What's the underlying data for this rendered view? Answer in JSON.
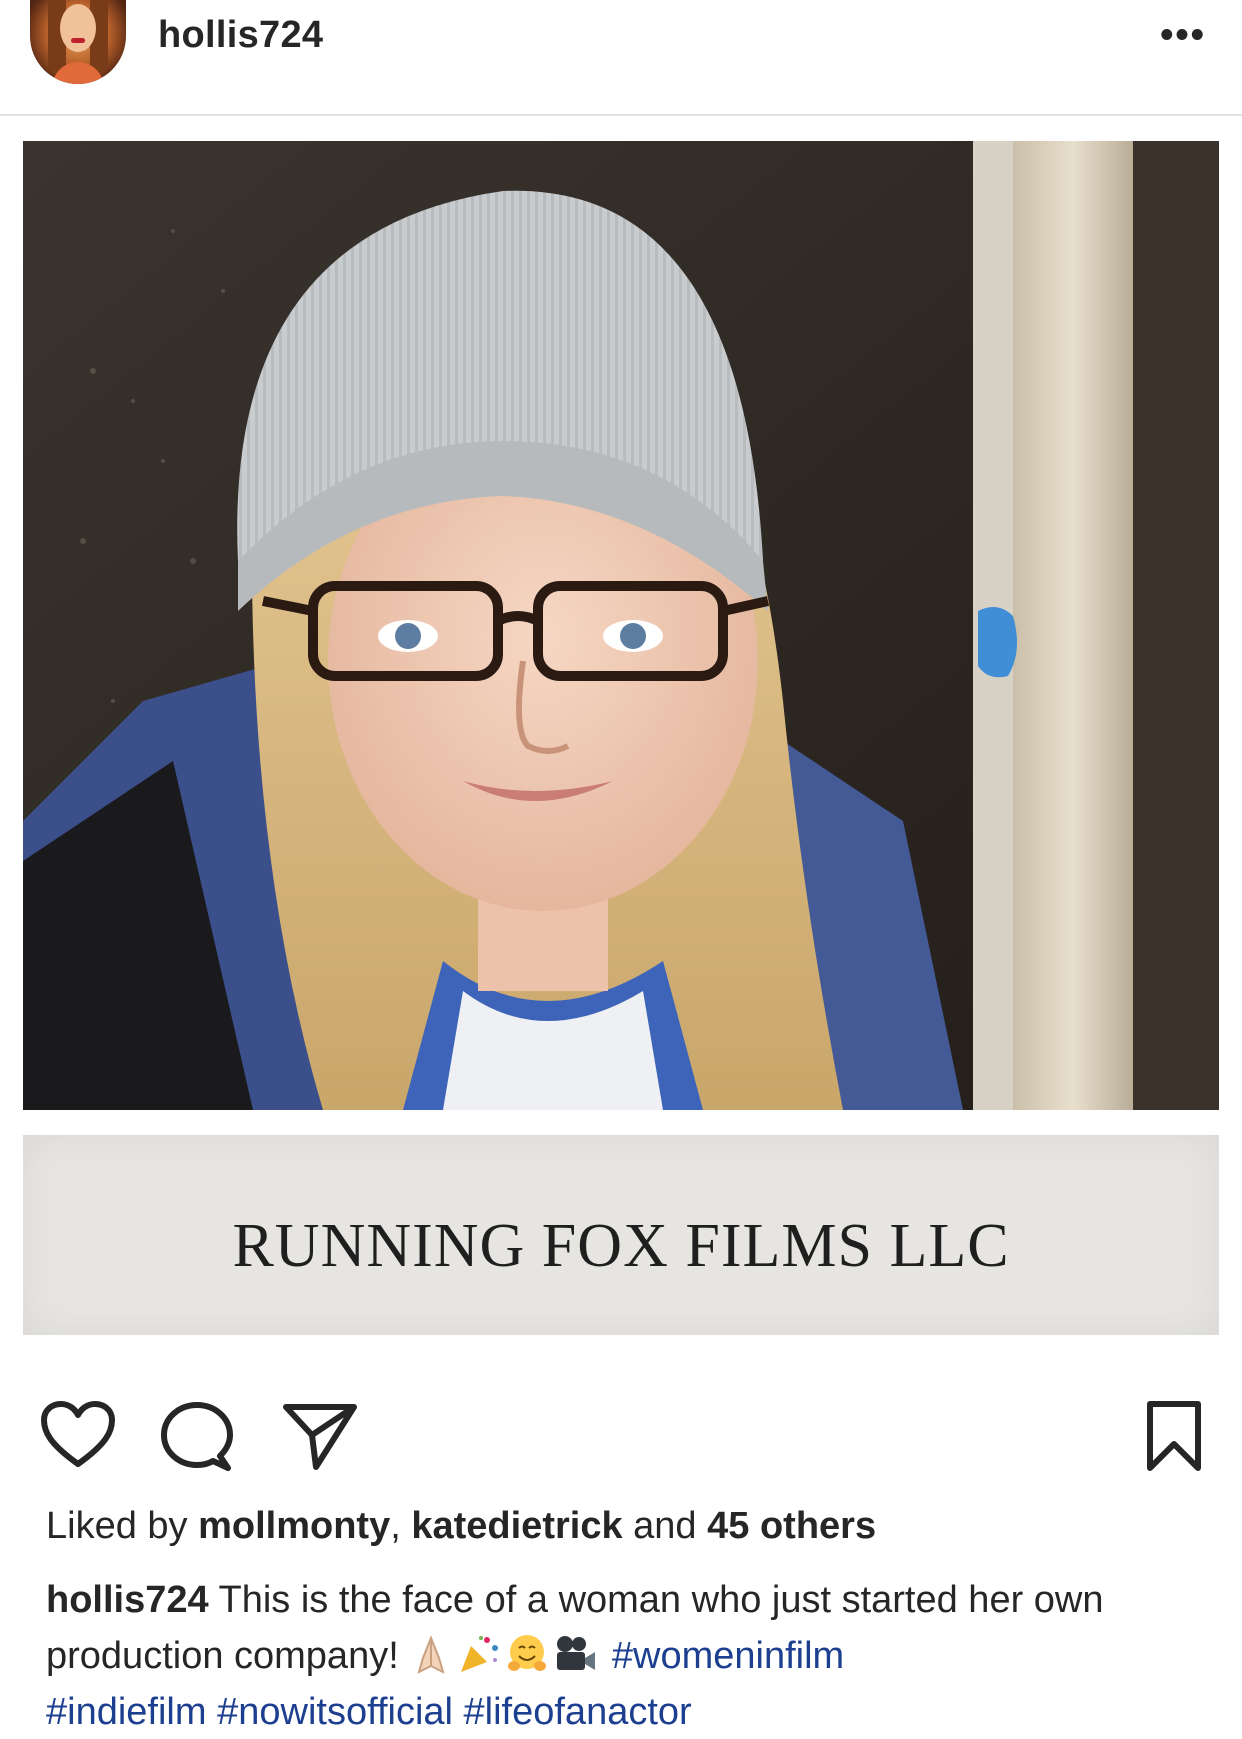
{
  "header": {
    "username": "hollis724",
    "more_label": "•••"
  },
  "strip": {
    "text": "RUNNING FOX FILMS LLC"
  },
  "actions": {
    "like_icon": "heart-icon",
    "comment_icon": "comment-icon",
    "share_icon": "send-icon",
    "save_icon": "bookmark-icon"
  },
  "likes": {
    "prefix": "Liked by",
    "user1": "mollmonty",
    "separator": ",",
    "user2": "katedietrick",
    "conjunction": "and",
    "others": "45 others"
  },
  "caption": {
    "username": "hollis724",
    "text": "This is the face of a woman who just started her own production company!",
    "emojis": [
      "folded-hands-emoji",
      "party-popper-emoji",
      "hugging-face-emoji",
      "movie-camera-emoji"
    ],
    "hashtags": [
      "#womeninfilm",
      "#indiefilm",
      "#nowitsofficial",
      "#lifeofanactor"
    ]
  },
  "colors": {
    "text": "#262626",
    "hashtag": "#1d3f8f",
    "divider": "#e3e3e3",
    "strip_bg": "#e6e5e2"
  }
}
